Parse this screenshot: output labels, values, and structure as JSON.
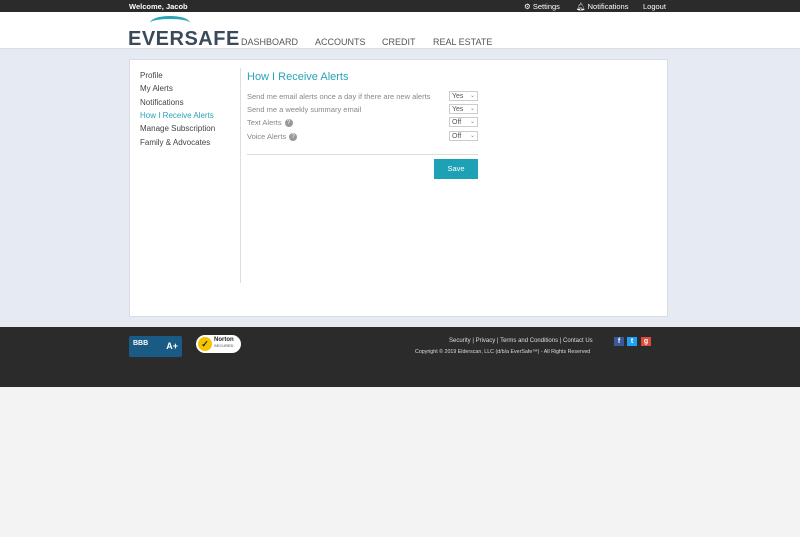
{
  "topbar": {
    "welcome": "Welcome, Jacob",
    "settings": "Settings",
    "notifications": "Notifications",
    "logout": "Logout"
  },
  "header": {
    "logo": "EVERSAFE",
    "nav": [
      "DASHBOARD",
      "ACCOUNTS",
      "CREDIT",
      "REAL ESTATE"
    ]
  },
  "sidebar": {
    "items": [
      {
        "label": "Profile"
      },
      {
        "label": "My Alerts"
      },
      {
        "label": "Notifications"
      },
      {
        "label": "How I Receive Alerts",
        "active": true
      },
      {
        "label": "Manage Subscription"
      },
      {
        "label": "Family & Advocates"
      }
    ]
  },
  "form": {
    "title": "How I Receive Alerts",
    "rows": [
      {
        "label": "Send me email alerts once a day if there are new alerts",
        "value": "Yes"
      },
      {
        "label": "Send me a weekly summary email",
        "value": "Yes"
      },
      {
        "label": "Text Alerts",
        "value": "Off",
        "help": true
      },
      {
        "label": "Voice Alerts",
        "value": "Off",
        "help": true
      }
    ],
    "save": "Save"
  },
  "footer": {
    "bbb": "A+",
    "norton": "Norton",
    "norton_sub": "SECURED",
    "links": [
      "Security",
      "Privacy",
      "Terms and Conditions",
      "Contact Us"
    ],
    "copyright": "Copyright © 2019 Elderscan, LLC (d/b/a EverSafe™) - All Rights Reserved"
  },
  "colors": {
    "accent": "#29a3b8",
    "dark": "#2b2b2b"
  }
}
